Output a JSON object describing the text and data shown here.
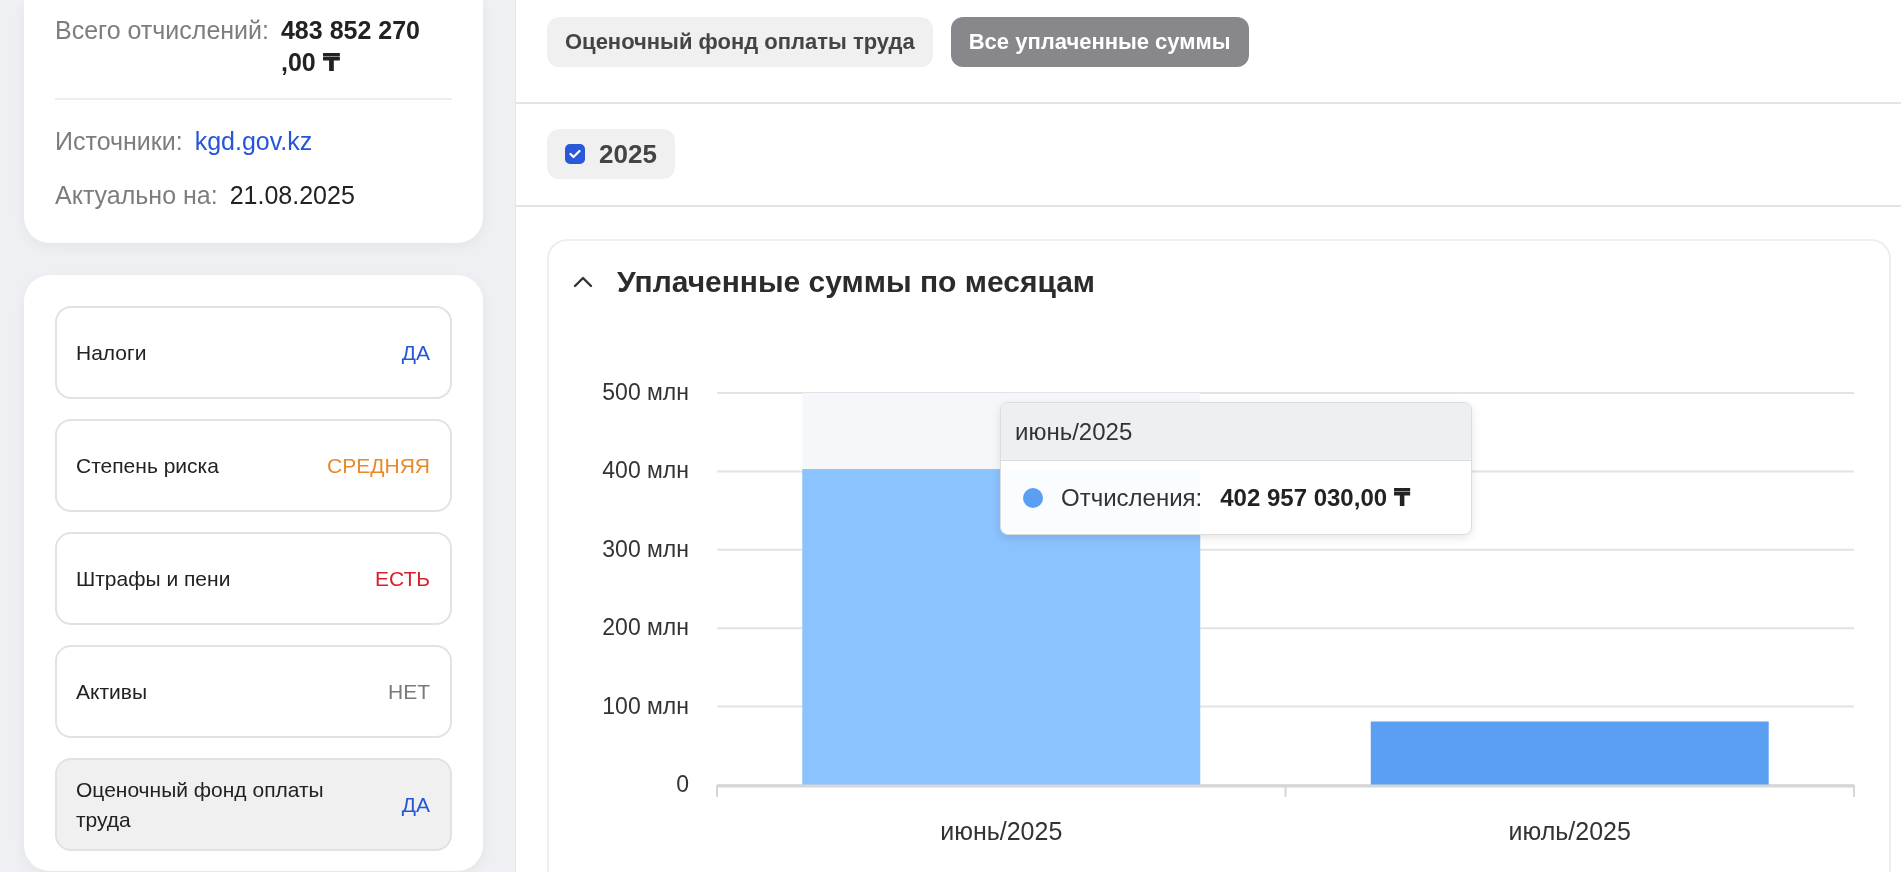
{
  "summary": {
    "rows": [
      {
        "kind": "amount",
        "label": "Всего отчислений:",
        "value": "483 852 270 ,00 ₸"
      },
      {
        "kind": "link",
        "label": "Источники:",
        "value": "kgd.gov.kz"
      },
      {
        "kind": "text",
        "label": "Актуально на:",
        "value": "21.08.2025"
      }
    ]
  },
  "indicators": [
    {
      "label": "Налоги",
      "status": "ДА",
      "color": "#2556d8",
      "selected": false
    },
    {
      "label": "Степень риска",
      "status": "СРЕДНЯЯ",
      "color": "#e8892b",
      "selected": false
    },
    {
      "label": "Штрафы и пени",
      "status": "ЕСТЬ",
      "color": "#d81f2d",
      "selected": false
    },
    {
      "label": "Активы",
      "status": "НЕТ",
      "color": "#7a7a7a",
      "selected": false
    },
    {
      "label": "Оценочный фонд оплаты труда",
      "status": "ДА",
      "color": "#2556d8",
      "selected": true
    }
  ],
  "tabs": [
    {
      "label": "Оценочный фонд оплаты труда",
      "selected": false
    },
    {
      "label": "Все уплаченные суммы",
      "selected": true
    }
  ],
  "years": [
    {
      "label": "2025",
      "checked": true
    }
  ],
  "chart_section": {
    "title": "Уплаченные суммы по месяцам",
    "expanded": true,
    "bar_states": [
      {
        "hovered": true
      },
      {
        "hovered": false
      }
    ],
    "tooltip": {
      "title": "июнь/2025",
      "label": "Отчисления:",
      "value": "402 957 030,00 ₸"
    },
    "chart_data": {
      "type": "bar",
      "categories": [
        "июнь/2025",
        "июль/2025"
      ],
      "series": [
        {
          "color": "#5b9ff2",
          "values": [
            403,
            81
          ]
        }
      ],
      "ylim": [
        0,
        500
      ],
      "grid": true,
      "yticks": [
        {
          "value": 0,
          "label": "0"
        },
        {
          "value": 100,
          "label": "100 млн"
        },
        {
          "value": 200,
          "label": "200 млн"
        },
        {
          "value": 300,
          "label": "300 млн"
        },
        {
          "value": 400,
          "label": "400 млн"
        },
        {
          "value": 500,
          "label": "500 млн"
        }
      ]
    }
  }
}
